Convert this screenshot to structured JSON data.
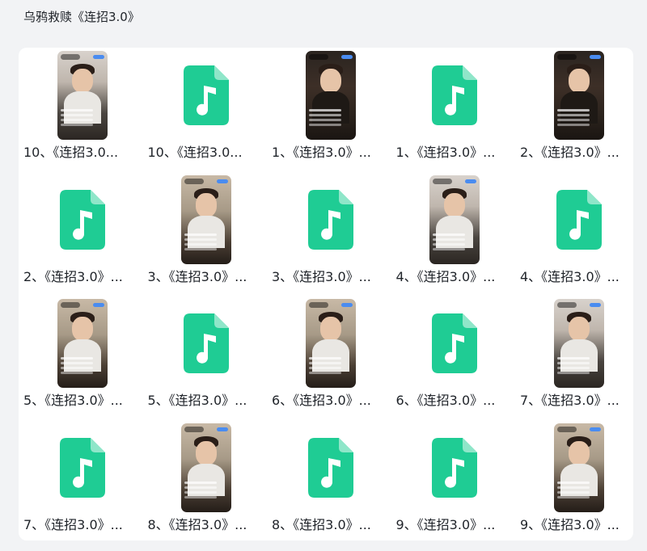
{
  "page": {
    "title": "乌鸦救赎《连招3.0》"
  },
  "colors": {
    "audio_icon": "#1fcc94",
    "card_background": "#ffffff",
    "page_background": "#f2f3f5"
  },
  "files": [
    {
      "label": "10、《连招3.0...",
      "type": "video",
      "icon": "video-thumbnail"
    },
    {
      "label": "10、《连招3.0...",
      "type": "audio",
      "icon": "music-file-icon"
    },
    {
      "label": "1、《连招3.0》...",
      "type": "video",
      "icon": "video-thumbnail"
    },
    {
      "label": "1、《连招3.0》...",
      "type": "audio",
      "icon": "music-file-icon"
    },
    {
      "label": "2、《连招3.0》...",
      "type": "video",
      "icon": "video-thumbnail"
    },
    {
      "label": "2、《连招3.0》...",
      "type": "audio",
      "icon": "music-file-icon"
    },
    {
      "label": "3、《连招3.0》...",
      "type": "video",
      "icon": "video-thumbnail"
    },
    {
      "label": "3、《连招3.0》...",
      "type": "audio",
      "icon": "music-file-icon"
    },
    {
      "label": "4、《连招3.0》...",
      "type": "video",
      "icon": "video-thumbnail"
    },
    {
      "label": "4、《连招3.0》...",
      "type": "audio",
      "icon": "music-file-icon"
    },
    {
      "label": "5、《连招3.0》...",
      "type": "video",
      "icon": "video-thumbnail"
    },
    {
      "label": "5、《连招3.0》...",
      "type": "audio",
      "icon": "music-file-icon"
    },
    {
      "label": "6、《连招3.0》...",
      "type": "video",
      "icon": "video-thumbnail"
    },
    {
      "label": "6、《连招3.0》...",
      "type": "audio",
      "icon": "music-file-icon"
    },
    {
      "label": "7、《连招3.0》...",
      "type": "video",
      "icon": "video-thumbnail"
    },
    {
      "label": "7、《连招3.0》...",
      "type": "audio",
      "icon": "music-file-icon"
    },
    {
      "label": "8、《连招3.0》...",
      "type": "video",
      "icon": "video-thumbnail"
    },
    {
      "label": "8、《连招3.0》...",
      "type": "audio",
      "icon": "music-file-icon"
    },
    {
      "label": "9、《连招3.0》...",
      "type": "audio",
      "icon": "music-file-icon"
    },
    {
      "label": "9、《连招3.0》...",
      "type": "video",
      "icon": "video-thumbnail"
    }
  ]
}
